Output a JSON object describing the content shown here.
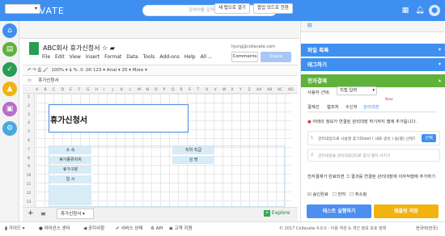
{
  "app": {
    "logo": "COLLAVATE",
    "search_placeholder": "검색어를 입력하십시오"
  },
  "toolbar": {
    "new_window": "새 탭으로 열기",
    "popup": "팝업 모드로 전환"
  },
  "sheet": {
    "title": "ABC회사 휴가신청서",
    "menu": [
      "File",
      "Edit",
      "View",
      "Insert",
      "Format",
      "Data",
      "Tools",
      "Add-ons",
      "Help",
      "All ..."
    ],
    "user": "hjung@collavate.com",
    "comments_label": "Comments",
    "share_label": "Share",
    "fmt": "100%   ▾   $   %   .0   .00   123 ▾   Arial   ▾   20   ▾   More ▾",
    "fx_label": "fx",
    "fx_value": "휴가신청서",
    "columns": [
      "A",
      "B",
      "C",
      "D",
      "E",
      "F",
      "G",
      "H",
      "I",
      "J",
      "K",
      "L",
      "M",
      "N",
      "O",
      "P",
      "Q",
      "R",
      "S",
      "T",
      "U",
      "V",
      "W",
      "X",
      "Y",
      "Z",
      "AA",
      "AB",
      "AC",
      "AD",
      "AE"
    ],
    "rows": [
      "1",
      "2",
      "3",
      "4",
      "5",
      "6",
      "7",
      "8",
      "9",
      "10",
      "11",
      "12",
      "13"
    ],
    "form_title": "휴가신청서",
    "labels_left": [
      "소 속",
      "휴가종류차처",
      "휴가구분",
      "일 시",
      ""
    ],
    "labels_right": [
      "직위 직급",
      "성 명"
    ],
    "tab_name": "휴가신청서",
    "explore": "Explore"
  },
  "panel": {
    "file_list": "파일 목록",
    "tag": "태그하기",
    "approval": "전자결재",
    "approver_label": "사용자 선택:",
    "approver_value": "직접 입력",
    "tabs": [
      "결재선",
      "협조처",
      "수신처",
      "관리대장"
    ],
    "new_badge": "New",
    "notice": "아래의 정보가 연결된 관리대장 하기까지 행에 추가됩니다.",
    "step1": "관리대장으로 사용할 휴가Sheet ( 새로 생성 ) 을(를) 선택하세요",
    "step1_btn": "선택",
    "step2": "관리대장을 관리대장(으)로 양식 절차 시키기",
    "bottom_text": "전자결재가 완료되면 그 결과를 연결된 관리대장에 이자적행에 추가하기",
    "checks": [
      "승인완료",
      "반려",
      "취소됨"
    ],
    "test_btn": "테스트 실행하기",
    "save_btn": "템플릿 저장"
  },
  "footer": {
    "items": [
      "가이드",
      "라이선스 센터",
      "공지사항",
      "서비스 상태",
      "API",
      "고객 지원"
    ],
    "copyright": "© 2017 Collavate 4.0.0 - 이용 약관 & 개인 정보 보호 정책",
    "lang": "한국어(한국)"
  },
  "colors": {
    "primary": "#3f8ff0",
    "green": "#5fb23a",
    "test_btn": "#4d8ff0",
    "save_btn": "#f2b311"
  }
}
